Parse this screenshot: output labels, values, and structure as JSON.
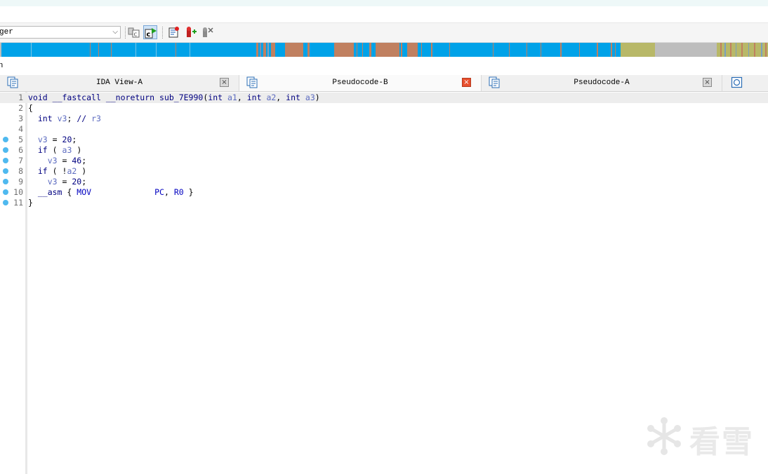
{
  "toolbar": {
    "debugger_select": {
      "value": "ger"
    },
    "buttons": [
      {
        "name": "use-source-button",
        "icon": "hex-to-c-icon"
      },
      {
        "name": "refresh-button",
        "icon": "c-run-icon",
        "active": true
      },
      {
        "name": "debugger-start-button",
        "icon": "book-run-icon"
      },
      {
        "name": "add-breakpoint-button",
        "icon": "add-breakpoint-icon"
      },
      {
        "name": "delete-breakpoint-button",
        "icon": "delete-breakpoint-icon"
      }
    ]
  },
  "navigation_band": {
    "colors": {
      "code": "#00a2e8",
      "data": "#c08060",
      "unexplored": "#b8b868",
      "other": "#bdbdbd"
    }
  },
  "sub_strip": {
    "text": "n"
  },
  "tabs": [
    {
      "label": "IDA View-A",
      "active": false
    },
    {
      "label": "Pseudocode-B",
      "active": true
    },
    {
      "label": "Pseudocode-A",
      "active": false
    }
  ],
  "code": {
    "lines": [
      {
        "num": "1",
        "bp": false,
        "text": "void __fastcall __noreturn sub_7E990(int a1, int a2, int a3)"
      },
      {
        "num": "2",
        "bp": false,
        "text": "{"
      },
      {
        "num": "3",
        "bp": false,
        "text": "  int v3; // r3"
      },
      {
        "num": "4",
        "bp": false,
        "text": ""
      },
      {
        "num": "5",
        "bp": true,
        "text": "  v3 = 20;"
      },
      {
        "num": "6",
        "bp": true,
        "text": "  if ( a3 )"
      },
      {
        "num": "7",
        "bp": true,
        "text": "    v3 = 46;"
      },
      {
        "num": "8",
        "bp": true,
        "text": "  if ( !a2 )"
      },
      {
        "num": "9",
        "bp": true,
        "text": "    v3 = 20;"
      },
      {
        "num": "10",
        "bp": true,
        "text": "  __asm { MOV             PC, R0 }"
      },
      {
        "num": "11",
        "bp": true,
        "text": "}"
      }
    ]
  },
  "watermark": {
    "text": "看雪",
    "icon": "snowflake-icon"
  }
}
